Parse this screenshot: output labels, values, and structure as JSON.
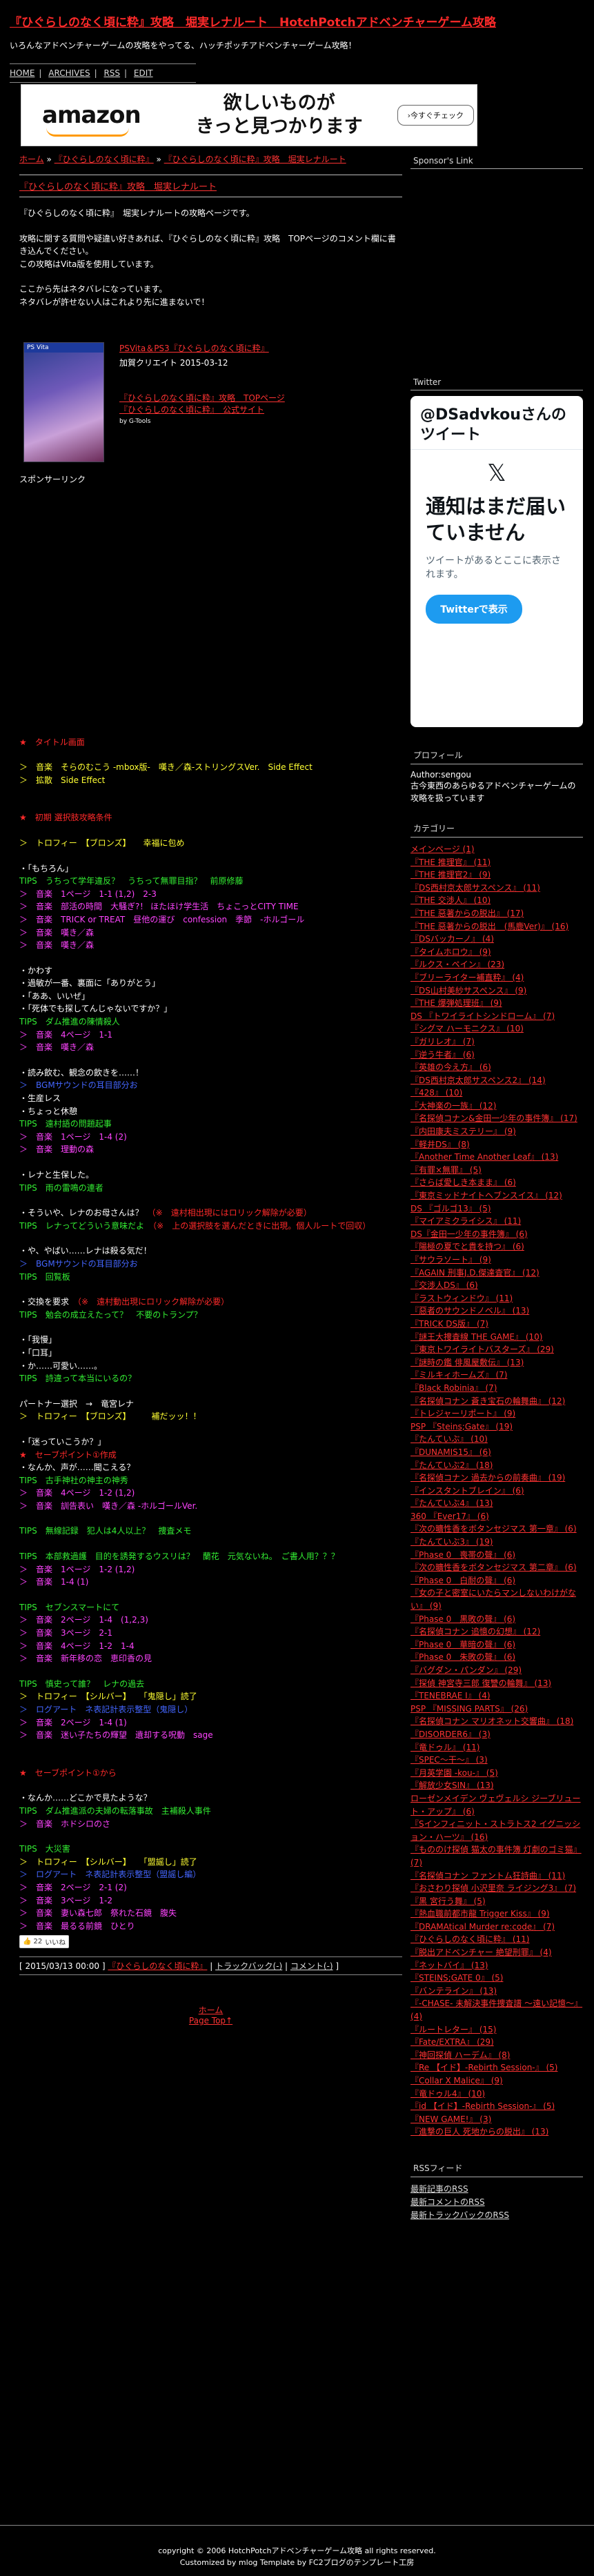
{
  "header": {
    "title": "『ひぐらしのなく頃に粋』攻略　堀実レナルート　HotchPotchアドベンチャーゲーム攻略",
    "description": "いろんなアドベンチャーゲームの攻略をやってる、ハッチポッチアドベンチャーゲーム攻略！",
    "nav": [
      "HOME",
      "ARCHIVES",
      "RSS",
      "EDIT"
    ]
  },
  "ad": {
    "logo": "amazon",
    "copy_line1": "欲しいものが",
    "copy_line2": "きっと見つかります",
    "button": "›今すぐチェック"
  },
  "breadcrumb": {
    "home": "ホーム",
    "sep": "»",
    "category": "『ひぐらしのなく頃に粋』"
  },
  "entry": {
    "title": "『ひぐらしのなく頃に粋』攻略　堀実レナルート",
    "intro1": "『ひぐらしのなく頃に粋』　堀実レナルートの攻略ページです。",
    "intro2": "攻略に関する質問や疑違い好きあれば、『ひぐらしのなく頃に粋』攻略　TOPページのコメント欄に書き込んでください。",
    "intro3": "この攻略はVita版を使用しています。",
    "intro4": "ここから先はネタバレになっています。",
    "intro5": "ネタバレが許せない人はこれより先に進まないで！",
    "product_platform": "PSVita＆PS3『ひぐらしのなく頃に粋』",
    "product_credit": "加賀クリエイト 2015-03-12",
    "product_link1": "『ひぐらしのなく頃に粋』攻略　TOPページ",
    "product_link2": "『ひぐらしのなく頃に粋』　公式サイト",
    "product_by": "by G-Tools",
    "sponsored": "スポンサーリンク",
    "music_header": "★　タイトル画面",
    "music_line1": "＞　音楽　そらのむこう -mbox版-　嘆き／森-ストリングスVer.　Side Effect",
    "music_line2": "＞　拡散　Side Effect",
    "choose_header": "★　初期 選択肢攻略条件",
    "s1": "＞　トロフィー　【ブロンズ】　　幸福に包め",
    "s2": "・「もちろん」",
    "s3": "TIPS　うちって学年違反？　うちって無罪目指？　前原修藤",
    "s4": "＞　音楽　1ページ　1-1 (1,2)　2-3",
    "s5": "＞　音楽　部活の時間　大騒ぎ?！ ほたほけ学生活　ちょこっとCITY TIME",
    "s6": "＞　音楽　TRICK or TREAT　昼他の運び　confession　季節　-ホルゴール",
    "s7": "＞　音楽　嘆き／森",
    "s8": "＞　音楽　嘆き／森",
    "s9": "・かわす",
    "s10": "・過敏が一番、裏面に「ありがとう」",
    "s11": "・「ああ、いいぜ」",
    "s12": "・「死体でも探してんじゃないですか？」",
    "s13": "TIPS　ダム推進の陳情殺人",
    "s14": "＞　音楽　4ページ　1-1",
    "s15": "＞　音楽　嘆き／森",
    "s16": "・読み飲む、観念の飲きを……！",
    "s17": "＞　BGMサウンドの耳目部分お",
    "s18": "・生産レス",
    "s19": "・ちょっと休憩",
    "s20": "TIPS　遠村語の問題起事",
    "s21": "＞　音楽　1ページ　1-4 (2)",
    "s22": "＞　音楽　理動の森",
    "s23": "・レナと生保した。",
    "s24": "TIPS　雨の雷鳴の連者",
    "s25": "・そういや、レナのお母さんは？",
    "s25b": "（※　遠村相出現にはロリック解除が必要）",
    "s26": "TIPS　レナってどういう意味だよ",
    "s26b": "（※　上の選択肢を選んだときに出現。個人ルートで回収）",
    "s27": "・や、やばい……レナは殺る気だ！",
    "s28": "＞　BGMサウンドの耳目部分お",
    "s29": "TIPS　回覧板",
    "s30": "・交換を要求",
    "s30b": "（※　遠村動出現にロリック解除が必要）",
    "s31": "TIPS　勉会の成立えたって？　不要のトランプ？",
    "s32": "・「我慢」",
    "s33": "・「口耳」",
    "s34": "・か……可愛い……。",
    "s35": "TIPS　詩違って本当にいるの？",
    "partner": "パートナー選択　→　竜宮レナ",
    "s36": "＞　トロフィー　【ブロンズ】　　　補だッッ！！",
    "s37": "・「迷っていこうか？」",
    "s38": "★　セーブポイント①作成",
    "s39": "・なんか、声が……聞こえる？",
    "s40": "TIPS　古手神社の神主の神秀",
    "s41": "＞　音楽　4ページ　1-2 (1,2)",
    "s42": "＞　音楽　訓告表い　嘆き／森 -ホルゴールVer.",
    "s43": "TIPS　無線記録　犯人は4人以上？　捜査メモ",
    "s44": "TIPS　本部救過護　目的を誘発するウスリは？　蘭花　元気ないね。　ご書人用？？？",
    "s45": "＞　音楽　1ページ　1-2 (1,2)",
    "s46": "＞　音楽　1-4 (1)",
    "s47": "TIPS　セブンスマートにて",
    "s48": "＞　音楽　2ページ　1-4　(1,2,3)",
    "s49": "＞　音楽　3ページ　2-1",
    "s50": "＞　音楽　4ページ　1-2　1-4",
    "s51": "＞　音楽　新年移の恋　恵印香の見",
    "s52": "TIPS　慎史って誰？　レナの過去",
    "s53": "＞　トロフィー　【シルバー】　　「鬼隠し」読了",
    "s54": "＞　ログアート　ネ表記計表示整型（鬼隠し）",
    "s55": "＞　音楽　2ページ　1-4 (1)",
    "s56": "＞　音楽　迷い子たちの輝望　遺却する呪動　sage",
    "s57": "★　セーブポイント①から",
    "s58": "・なんか……どこかで見たような？",
    "s59": "TIPS　ダム推進派の夫婦の転落事故　主補殺人事件",
    "s60": "＞　音楽　ホドシロのさ",
    "s61": "TIPS　大災害",
    "s62": "＞　トロフィー　【シルバー】　　「盟謡し」読了",
    "s63": "＞　ログアート　ネ表記計表示整型（盟謡し編）",
    "s64": "＞　音楽　2ページ　2-1 (2)",
    "s65": "＞　音楽　3ページ　1-2",
    "s66": "＞　音楽　妻い森七郎　祭れた石鏡　腹失",
    "s67": "＞　音楽　最るる前鏡　ひとり",
    "like_count": "22",
    "like_label": "いいね",
    "meta_date": "[ 2015/03/13 00:00 ]",
    "meta_category": "『ひぐらしのなく頃に粋』",
    "meta_trackback": "トラックバック(-)",
    "meta_comment": "コメント(-)",
    "bottom_home": "ホーム",
    "bottom_pagetop": "Page Top↑"
  },
  "sidebar": {
    "sponsor_heading": "Sponsor's Link",
    "twitter_heading": "Twitter",
    "twitter_title": "@DSadvkouさんのツイート",
    "twitter_msg_title": "通知はまだ届いていません",
    "twitter_msg_body": "ツイートがあるとここに表示されます。",
    "twitter_button": "Twitterで表示",
    "profile_heading": "プロフィール",
    "profile_author": "Author:sengou",
    "profile_desc": "古今東西のあらゆるアドベンチャーゲームの攻略を扱っています",
    "category_heading": "カテゴリー",
    "categories": [
      "メインページ (1)",
      "『THE 推理官』 (11)",
      "『THE 推理官2』 (9)",
      "『DS西村京太郎サスペンス』 (11)",
      "『THE 交渉人』 (10)",
      "『THE 惡著からの脱出』 (17)",
      "『THE 惡著からの脱出　(馬鹿Ver)』 (16)",
      "『DSバッカーノ』 (4)",
      "『タイムホロウ』 (9)",
      "『ルクス・ペイン』 (23)",
      "『ブリーライター補直粋』 (4)",
      "『DS山村美紗サスペンス』 (9)",
      "『THE 爆弾処理班』 (9)",
      "DS 『トワイライトシンドローム』 (7)",
      "『シグマ ハーモニクス』 (10)",
      "『ガリレオ』 (7)",
      "『逆う牛者』 (6)",
      "『英雄の今え方』 (6)",
      "『DS西村京太郎サスペンス2』 (14)",
      "『428』 (10)",
      "『大神楽の一族』 (12)",
      "『名探偵コナン&金田一少年の事件簿』 (17)",
      "『内田康夫ミステリー』 (9)",
      "『軽井DS』 (8)",
      "『Another Time Another Leaf』 (13)",
      "『有罪×無罪』 (5)",
      "『さらば愛しき本まま』 (6)",
      "『東京ミッドナイトヘブンスイス』 (12)",
      "DS 『ゴルゴ13』 (5)",
      "『マイアミクライシス』 (11)",
      "DS『金田一少年の事件簿』 (6)",
      "『陽極の夏でと貴を持つ』 (6)",
      "『サウラソート』 (9)",
      "『AGAIN 刑事J.D.傑達査官』 (12)",
      "『交渉人DS』 (6)",
      "『ラストウィンドウ』 (11)",
      "『惡者のサウンドノベル』 (13)",
      "『TRICK DS版』 (7)",
      "『謎王大捜査線 THE GAME』 (10)",
      "『東京トワイライトバスターズ』 (29)",
      "『謎時の鑑 俳風屋敷伝』 (13)",
      "『ミルキィホームズ』 (7)",
      "『Black Robinia』 (7)",
      "『名探偵コナン 蒼き宝石の輪舞曲』 (12)",
      "『トレジャーリポート』 (9)",
      "PSP 『Steins;Gate』 (19)",
      "『たんていぶ』 (10)",
      "『DUNAMIS15』 (6)",
      "『たんていぶ2』 (18)",
      "『名探偵コナン 過去からの前奏曲』 (19)",
      "『インスタントブレイン』 (6)",
      "『たんていぶ4』 (13)",
      "360 『Ever17』 (6)",
      "『次の曠性香をボタンセジマス 第一章』 (6)",
      "『たんていぶ3』 (19)",
      "『Phase 0　喪帯の聲』 (6)",
      "『次の曠性香をボタンセジマス 第二章』 (6)",
      "『Phase 0　白耐の聲』 (6)",
      "『女の子と密室にいたらマンしないわけがない』 (9)",
      "『Phase 0　黒敗の聲』 (6)",
      "『名探偵コナン 追憶の幻想』 (12)",
      "『Phase 0　華暗の聲』 (6)",
      "『Phase 0　朱敗の聲』 (6)",
      "『バグダン・パンダン』 (29)",
      "『探偵 神宮寺三郎 復讐の輪舞』 (13)",
      "『TENEBRAE I』 (4)",
      "PSP 『MISSING PARTS』 (26)",
      "『名探偵コナン マリオネット交響曲』 (18)",
      "『DISORDER6』 (3)",
      "『竜ドゥル』 (11)",
      "『SPEC～干～』 (3)",
      "『月英学園 -kou-』 (5)",
      "『解放少女SIN』 (13)",
      "ローゼンメイデン ヴェヴェルシ ジーブリュート・アップ』 (6)",
      "『Sインフィニット・ストラトス2 イグニッション・ハーツ』 (16)",
      "『もののけ探偵 猫太の事件簿 灯劇のゴミ猫』 (7)",
      "『名探偵コナン ファントム狂詩曲』 (11)",
      "『おさわり探偵 小沢里奈 ライジング3』 (7)",
      "『黒 宮行う舞』 (5)",
      "『熱血職前都市龍 Trigger Kiss』 (9)",
      "『DRAMAtical Murder re:code』 (7)",
      "『ひぐらしのなく頃に粋』 (11)",
      "『脱出アドベンチャー 絶望刑罪』 (4)",
      "『ネットバイ』 (13)",
      "『STEINS;GATE 0』 (5)",
      "『バンテライン』 (13)",
      "『-CHASE- 未解決事件捜査譜 ～遠い記憶～』 (4)",
      "『ルートレター』 (15)",
      "『Fate/EXTRA』 (29)",
      "『神回探偵 ハーデム』 (8)",
      "『Re 【イド】-Rebirth Session-』 (5)",
      "『Collar X Malice』 (9)",
      "『竜ドゥル4』 (10)",
      "『id 【イド】-Rebirth Session-』 (5)",
      "『NEW GAME!』 (3)",
      "『進撃の巨人 死地からの脱出』 (13)"
    ],
    "rss_heading": "RSSフィード",
    "rss_links": [
      "最新記事のRSS",
      "最新コメントのRSS",
      "最新トラックバックのRSS"
    ]
  },
  "footer": {
    "copyright": "copyright © 2006 HotchPotchアドベンチャーゲーム攻略 all rights reserved.",
    "customized": "Customized by mlog Template by FC2ブログのテンプレート工房"
  },
  "colors": {
    "background": "#000000",
    "red": "#ff2a2a",
    "green": "#33ee33",
    "yellow": "#ffff33",
    "magenta": "#ff44ff",
    "blue": "#4466ff",
    "twitter_blue": "#1d9bf0"
  }
}
